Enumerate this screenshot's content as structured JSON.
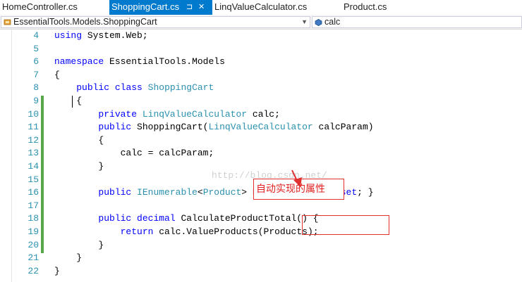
{
  "tabs": [
    {
      "label": "HomeController.cs",
      "active": false
    },
    {
      "label": "ShoppingCart.cs",
      "active": true,
      "pin": "⊐",
      "close": "✕"
    },
    {
      "label": "LinqValueCalculator.cs",
      "active": false
    },
    {
      "label": "Product.cs",
      "active": false
    }
  ],
  "navbar": {
    "type_dropdown": "EssentialTools.Models.ShoppingCart",
    "member_dropdown": "calc"
  },
  "code_lines": [
    {
      "n": "4",
      "text": "using System.Web;"
    },
    {
      "n": "5",
      "text": ""
    },
    {
      "n": "6",
      "text": "namespace EssentialTools.Models"
    },
    {
      "n": "7",
      "text": "{"
    },
    {
      "n": "8",
      "text": "    public class ShoppingCart"
    },
    {
      "n": "9",
      "text": "    {"
    },
    {
      "n": "10",
      "text": "        private LinqValueCalculator calc;"
    },
    {
      "n": "11",
      "text": "        public ShoppingCart(LinqValueCalculator calcParam)"
    },
    {
      "n": "12",
      "text": "        {"
    },
    {
      "n": "13",
      "text": "            calc = calcParam;"
    },
    {
      "n": "14",
      "text": "        }"
    },
    {
      "n": "15",
      "text": ""
    },
    {
      "n": "16",
      "text": "        public IEnumerable<Product> Products { get; set; }"
    },
    {
      "n": "17",
      "text": ""
    },
    {
      "n": "18",
      "text": "        public decimal CalculateProductTotal() {"
    },
    {
      "n": "19",
      "text": "            return calc.ValueProducts(Products);"
    },
    {
      "n": "20",
      "text": "        }"
    },
    {
      "n": "21",
      "text": "    }"
    },
    {
      "n": "22",
      "text": "}"
    }
  ],
  "annotation": {
    "label": "自动实现的属性"
  },
  "watermark": "http://blog.csdn.net/",
  "colors": {
    "accent": "#007acc",
    "keyword": "#0000ff",
    "type": "#2b91af",
    "annotation": "#e03030",
    "changebar": "#57a64a"
  }
}
